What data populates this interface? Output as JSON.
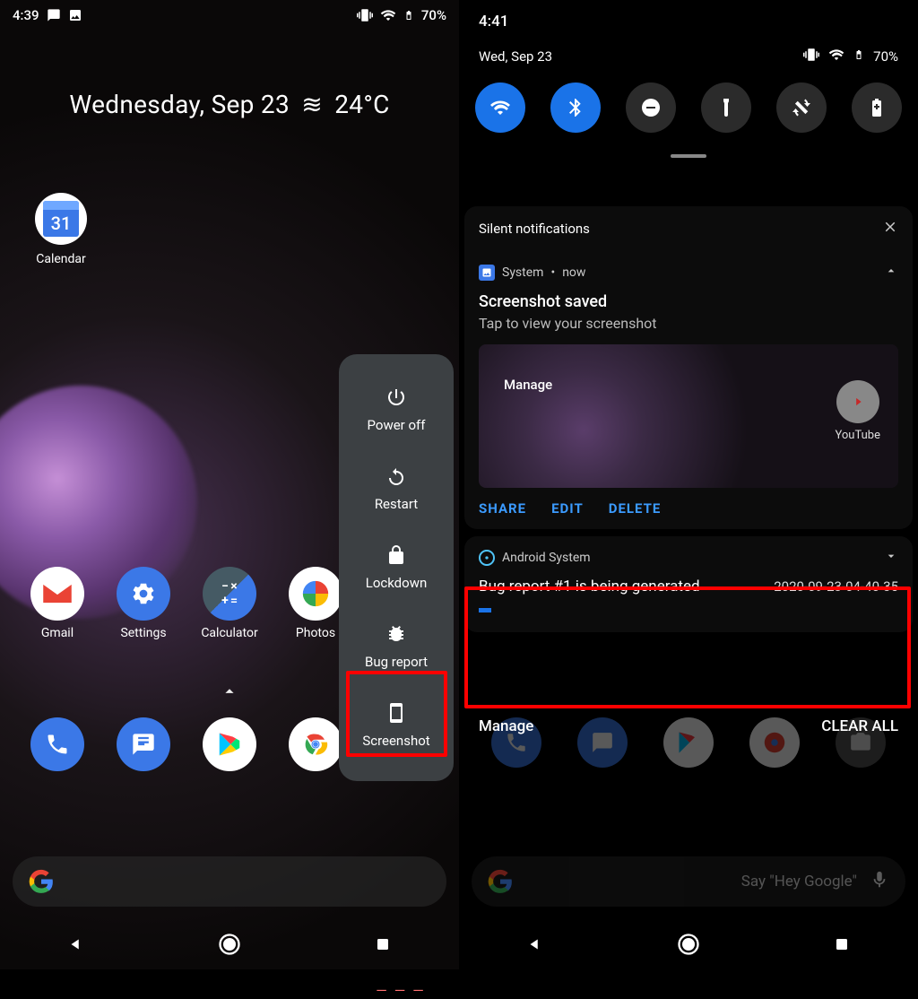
{
  "left": {
    "status": {
      "time": "4:39",
      "battery": "70%"
    },
    "widget": {
      "date": "Wednesday, Sep 23",
      "temp": "24°C"
    },
    "calendar": {
      "num": "31",
      "label": "Calendar"
    },
    "apps_row": [
      {
        "label": "Gmail"
      },
      {
        "label": "Settings"
      },
      {
        "label": "Calculator"
      },
      {
        "label": "Photos"
      }
    ],
    "power_menu": {
      "power_off": "Power off",
      "restart": "Restart",
      "lockdown": "Lockdown",
      "bug_report": "Bug report",
      "screenshot": "Screenshot"
    }
  },
  "right": {
    "status": {
      "time": "4:41",
      "battery": "70%"
    },
    "shade_date": "Wed, Sep 23",
    "silent_head": "Silent notifications",
    "ss_notif": {
      "app": "System",
      "time": "now",
      "title": "Screenshot saved",
      "body": "Tap to view your screenshot",
      "manage": "Manage",
      "youtube": "YouTube",
      "share": "SHARE",
      "edit": "EDIT",
      "delete": "DELETE"
    },
    "bug_notif": {
      "app": "Android System",
      "title": "Bug report #1 is being generated",
      "timestamp": "2020-09-23-04-40-35"
    },
    "manage_row": {
      "manage": "Manage",
      "clear": "CLEAR ALL"
    },
    "gbar_hint": "Say \"Hey Google\""
  }
}
